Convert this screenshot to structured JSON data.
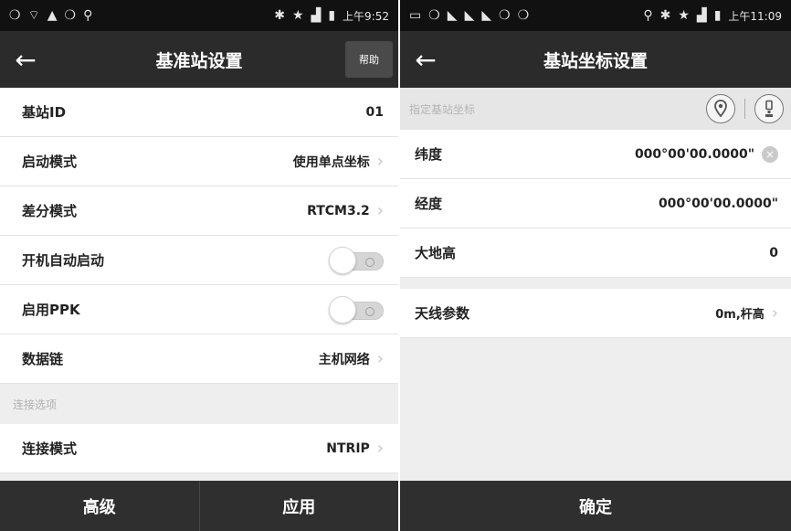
{
  "left": {
    "status": {
      "icons_left": [
        "❍",
        "⌔",
        "▲",
        "❍",
        "⚲"
      ],
      "icons_right": [
        "✱",
        "★",
        "▟",
        "▮"
      ],
      "time": "上午9:52"
    },
    "title": "基准站设置",
    "help_label": "帮助",
    "rows": [
      {
        "label": "基站ID",
        "value": "01"
      },
      {
        "label": "启动模式",
        "value": "使用单点坐标"
      },
      {
        "label": "差分模式",
        "value": "RTCM3.2"
      },
      {
        "label": "开机自动启动",
        "toggle": false
      },
      {
        "label": "启用PPK",
        "toggle": false
      },
      {
        "label": "数据链",
        "value": "主机网络"
      }
    ],
    "section": "连接选项",
    "connect_row": {
      "label": "连接模式",
      "value": "NTRIP"
    },
    "buttons": [
      "高级",
      "应用"
    ]
  },
  "right": {
    "status": {
      "icons_left": [
        "▭",
        "❍",
        "◣",
        "◣",
        "◣",
        "❍",
        "❍"
      ],
      "icons_right": [
        "⚲",
        "✱",
        "★",
        "▟",
        "▮"
      ],
      "time": "上午11:09"
    },
    "title": "基站坐标设置",
    "section": "指定基站坐标",
    "rows": [
      {
        "label": "纬度",
        "value": "000°00'00.0000\""
      },
      {
        "label": "经度",
        "value": "000°00'00.0000\""
      },
      {
        "label": "大地高",
        "value": "0"
      }
    ],
    "antenna": {
      "label": "天线参数",
      "value": "0m,杆高"
    },
    "button": "确定"
  },
  "glyphs": {
    "back": "←",
    "chevron": "›",
    "clear": "×"
  }
}
